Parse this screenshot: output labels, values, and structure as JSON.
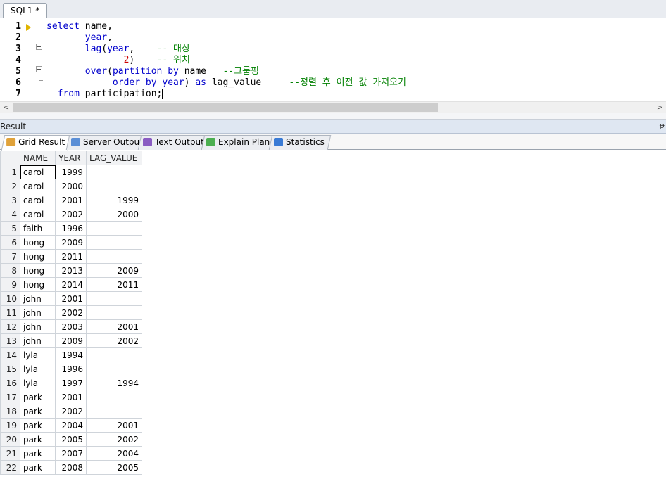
{
  "editor_tab": {
    "label": "SQL1 *"
  },
  "editor": {
    "lines": [
      {
        "num": "1",
        "parts": [
          [
            "kw",
            "select "
          ],
          [
            "id",
            "name,"
          ]
        ]
      },
      {
        "num": "2",
        "parts": [
          [
            "id",
            "       "
          ],
          [
            "kw",
            "year"
          ],
          [
            "id",
            ","
          ]
        ]
      },
      {
        "num": "3",
        "parts": [
          [
            "id",
            "       "
          ],
          [
            "kw",
            "lag"
          ],
          [
            "id",
            "("
          ],
          [
            "kw",
            "year"
          ],
          [
            "id",
            ",    "
          ],
          [
            "cm",
            "-- 대상"
          ]
        ]
      },
      {
        "num": "4",
        "parts": [
          [
            "id",
            "              "
          ],
          [
            "num",
            "2"
          ],
          [
            "id",
            ")    "
          ],
          [
            "cm",
            "-- 위치"
          ]
        ]
      },
      {
        "num": "5",
        "parts": [
          [
            "id",
            "       "
          ],
          [
            "kw",
            "over"
          ],
          [
            "id",
            "("
          ],
          [
            "kw",
            "partition by "
          ],
          [
            "id",
            "name   "
          ],
          [
            "cm",
            "--그룹핑"
          ]
        ]
      },
      {
        "num": "6",
        "parts": [
          [
            "id",
            "            "
          ],
          [
            "kw",
            "order by year"
          ],
          [
            "id",
            ") "
          ],
          [
            "kw",
            "as "
          ],
          [
            "id",
            "lag_value     "
          ],
          [
            "cm",
            "--정렬 후 이전 값 가져오기"
          ]
        ]
      },
      {
        "num": "7",
        "parts": [
          [
            "id",
            "  "
          ],
          [
            "kw",
            "from "
          ],
          [
            "id",
            "participation;"
          ]
        ]
      }
    ]
  },
  "scrollbar": {
    "left_arrow": "<",
    "right_arrow": ">"
  },
  "result_panel": {
    "title": "Result",
    "pin": "ᵽ"
  },
  "result_tabs": [
    {
      "label": "Grid Result",
      "icon": "grid-icon",
      "color": "#e0a23a",
      "active": true
    },
    {
      "label": "Server Output",
      "icon": "server-output-icon",
      "color": "#5b8fd6",
      "active": false
    },
    {
      "label": "Text Output",
      "icon": "text-output-icon",
      "color": "#8a5cc2",
      "active": false
    },
    {
      "label": "Explain Plan",
      "icon": "explain-plan-icon",
      "color": "#4caf50",
      "active": false
    },
    {
      "label": "Statistics",
      "icon": "statistics-icon",
      "color": "#3a7bd5",
      "active": false
    }
  ],
  "grid": {
    "columns": [
      "NAME",
      "YEAR",
      "LAG_VALUE"
    ],
    "rows": [
      [
        "1",
        "carol",
        "1999",
        ""
      ],
      [
        "2",
        "carol",
        "2000",
        ""
      ],
      [
        "3",
        "carol",
        "2001",
        "1999"
      ],
      [
        "4",
        "carol",
        "2002",
        "2000"
      ],
      [
        "5",
        "faith",
        "1996",
        ""
      ],
      [
        "6",
        "hong",
        "2009",
        ""
      ],
      [
        "7",
        "hong",
        "2011",
        ""
      ],
      [
        "8",
        "hong",
        "2013",
        "2009"
      ],
      [
        "9",
        "hong",
        "2014",
        "2011"
      ],
      [
        "10",
        "john",
        "2001",
        ""
      ],
      [
        "11",
        "john",
        "2002",
        ""
      ],
      [
        "12",
        "john",
        "2003",
        "2001"
      ],
      [
        "13",
        "john",
        "2009",
        "2002"
      ],
      [
        "14",
        "lyla",
        "1994",
        ""
      ],
      [
        "15",
        "lyla",
        "1996",
        ""
      ],
      [
        "16",
        "lyla",
        "1997",
        "1994"
      ],
      [
        "17",
        "park",
        "2001",
        ""
      ],
      [
        "18",
        "park",
        "2002",
        ""
      ],
      [
        "19",
        "park",
        "2004",
        "2001"
      ],
      [
        "20",
        "park",
        "2005",
        "2002"
      ],
      [
        "21",
        "park",
        "2007",
        "2004"
      ],
      [
        "22",
        "park",
        "2008",
        "2005"
      ]
    ]
  }
}
